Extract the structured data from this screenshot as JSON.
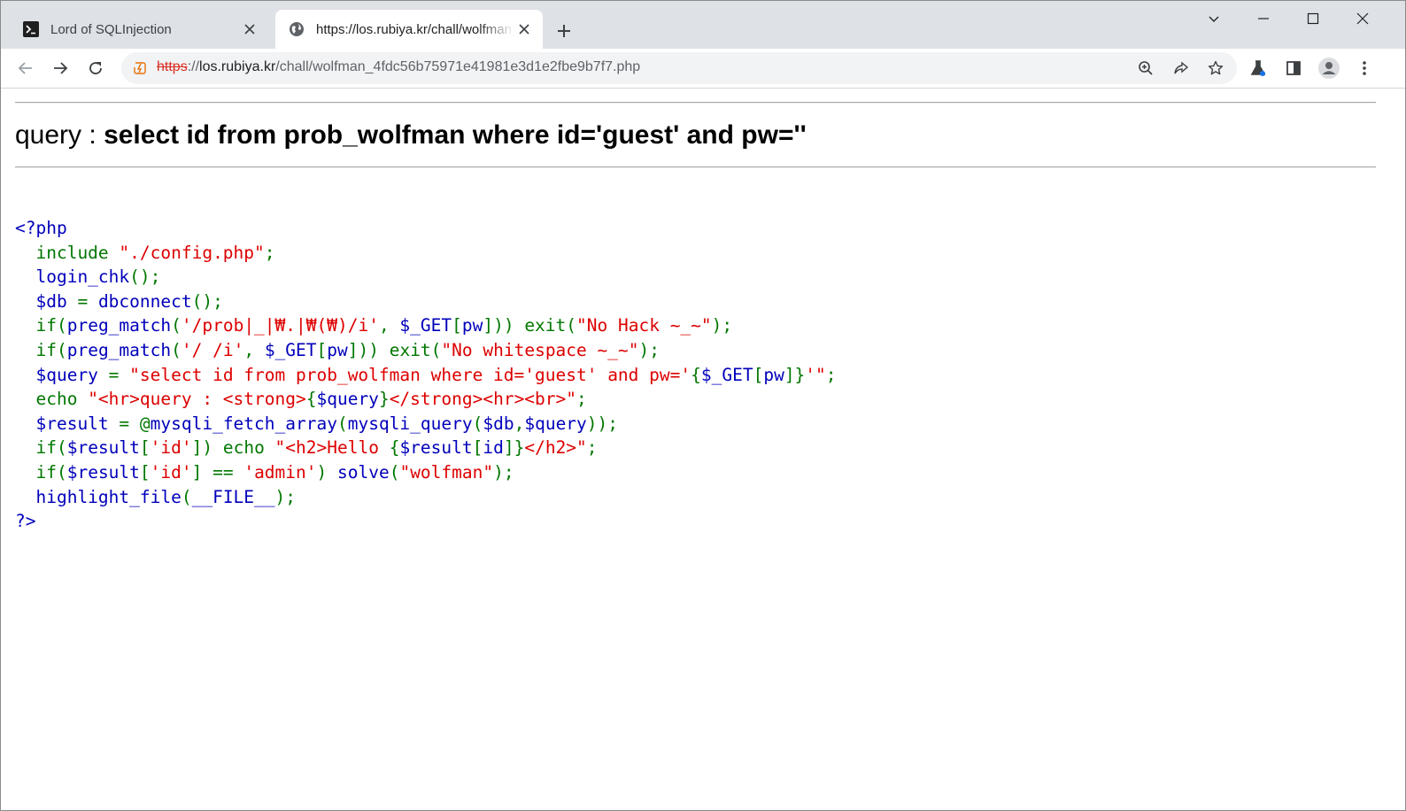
{
  "tabs": [
    {
      "title": "Lord of SQLInjection",
      "icon": "terminal-icon"
    },
    {
      "title": "https://los.rubiya.kr/chall/wolfman_4fdc56b75971e41981e3d1e2fbe9b7f7.php",
      "icon": "globe-icon"
    }
  ],
  "address_bar": {
    "scheme": "https",
    "rest": "://",
    "host": "los.rubiya.kr",
    "path": "/chall/wolfman_4fdc56b75971e41981e3d1e2fbe9b7f7.php"
  },
  "page": {
    "query_label": "query : ",
    "query_value": "select id from prob_wolfman where id='guest' and pw=''"
  },
  "source_lines": [
    [
      {
        "c": "d",
        "t": "<?php"
      }
    ],
    [
      {
        "c": "d",
        "t": "  "
      },
      {
        "c": "k",
        "t": "include "
      },
      {
        "c": "s",
        "t": "\"./config.php\""
      },
      {
        "c": "k",
        "t": ";"
      }
    ],
    [
      {
        "c": "d",
        "t": "  login_chk"
      },
      {
        "c": "k",
        "t": "();"
      }
    ],
    [
      {
        "c": "d",
        "t": "  $db "
      },
      {
        "c": "k",
        "t": "= "
      },
      {
        "c": "d",
        "t": "dbconnect"
      },
      {
        "c": "k",
        "t": "();"
      }
    ],
    [
      {
        "c": "d",
        "t": "  "
      },
      {
        "c": "k",
        "t": "if("
      },
      {
        "c": "d",
        "t": "preg_match"
      },
      {
        "c": "k",
        "t": "("
      },
      {
        "c": "s",
        "t": "'/prob|_|₩.|₩(₩)/i'"
      },
      {
        "c": "k",
        "t": ", "
      },
      {
        "c": "d",
        "t": "$_GET"
      },
      {
        "c": "k",
        "t": "["
      },
      {
        "c": "d",
        "t": "pw"
      },
      {
        "c": "k",
        "t": "])) exit("
      },
      {
        "c": "s",
        "t": "\"No Hack ~_~\""
      },
      {
        "c": "k",
        "t": ");"
      }
    ],
    [
      {
        "c": "d",
        "t": "  "
      },
      {
        "c": "k",
        "t": "if("
      },
      {
        "c": "d",
        "t": "preg_match"
      },
      {
        "c": "k",
        "t": "("
      },
      {
        "c": "s",
        "t": "'/ /i'"
      },
      {
        "c": "k",
        "t": ", "
      },
      {
        "c": "d",
        "t": "$_GET"
      },
      {
        "c": "k",
        "t": "["
      },
      {
        "c": "d",
        "t": "pw"
      },
      {
        "c": "k",
        "t": "])) exit("
      },
      {
        "c": "s",
        "t": "\"No whitespace ~_~\""
      },
      {
        "c": "k",
        "t": ");"
      }
    ],
    [
      {
        "c": "d",
        "t": "  $query "
      },
      {
        "c": "k",
        "t": "= "
      },
      {
        "c": "s",
        "t": "\"select id from prob_wolfman where id='guest' and pw='"
      },
      {
        "c": "k",
        "t": "{"
      },
      {
        "c": "d",
        "t": "$_GET"
      },
      {
        "c": "k",
        "t": "["
      },
      {
        "c": "d",
        "t": "pw"
      },
      {
        "c": "k",
        "t": "]}"
      },
      {
        "c": "s",
        "t": "'\""
      },
      {
        "c": "k",
        "t": ";"
      }
    ],
    [
      {
        "c": "d",
        "t": "  "
      },
      {
        "c": "k",
        "t": "echo "
      },
      {
        "c": "s",
        "t": "\"<hr>query : <strong>"
      },
      {
        "c": "k",
        "t": "{"
      },
      {
        "c": "d",
        "t": "$query"
      },
      {
        "c": "k",
        "t": "}"
      },
      {
        "c": "s",
        "t": "</strong><hr><br>\""
      },
      {
        "c": "k",
        "t": ";"
      }
    ],
    [
      {
        "c": "d",
        "t": "  $result "
      },
      {
        "c": "k",
        "t": "= @"
      },
      {
        "c": "d",
        "t": "mysqli_fetch_array"
      },
      {
        "c": "k",
        "t": "("
      },
      {
        "c": "d",
        "t": "mysqli_query"
      },
      {
        "c": "k",
        "t": "("
      },
      {
        "c": "d",
        "t": "$db"
      },
      {
        "c": "k",
        "t": ","
      },
      {
        "c": "d",
        "t": "$query"
      },
      {
        "c": "k",
        "t": "));"
      }
    ],
    [
      {
        "c": "d",
        "t": "  "
      },
      {
        "c": "k",
        "t": "if("
      },
      {
        "c": "d",
        "t": "$result"
      },
      {
        "c": "k",
        "t": "["
      },
      {
        "c": "s",
        "t": "'id'"
      },
      {
        "c": "k",
        "t": "]) echo "
      },
      {
        "c": "s",
        "t": "\"<h2>Hello "
      },
      {
        "c": "k",
        "t": "{"
      },
      {
        "c": "d",
        "t": "$result"
      },
      {
        "c": "k",
        "t": "["
      },
      {
        "c": "d",
        "t": "id"
      },
      {
        "c": "k",
        "t": "]}"
      },
      {
        "c": "s",
        "t": "</h2>\""
      },
      {
        "c": "k",
        "t": ";"
      }
    ],
    [
      {
        "c": "d",
        "t": "  "
      },
      {
        "c": "k",
        "t": "if("
      },
      {
        "c": "d",
        "t": "$result"
      },
      {
        "c": "k",
        "t": "["
      },
      {
        "c": "s",
        "t": "'id'"
      },
      {
        "c": "k",
        "t": "] == "
      },
      {
        "c": "s",
        "t": "'admin'"
      },
      {
        "c": "k",
        "t": ") "
      },
      {
        "c": "d",
        "t": "solve"
      },
      {
        "c": "k",
        "t": "("
      },
      {
        "c": "s",
        "t": "\"wolfman\""
      },
      {
        "c": "k",
        "t": ");"
      }
    ],
    [
      {
        "c": "d",
        "t": "  highlight_file"
      },
      {
        "c": "k",
        "t": "("
      },
      {
        "c": "d",
        "t": "__FILE__"
      },
      {
        "c": "k",
        "t": ");"
      }
    ],
    [
      {
        "c": "d",
        "t": "?>"
      }
    ]
  ],
  "colors": {
    "php_default": "#0000bb",
    "php_keyword": "#007700",
    "php_string": "#dd0000",
    "tabstrip_bg": "#dee1e6",
    "insecure_scheme": "#d93025"
  }
}
